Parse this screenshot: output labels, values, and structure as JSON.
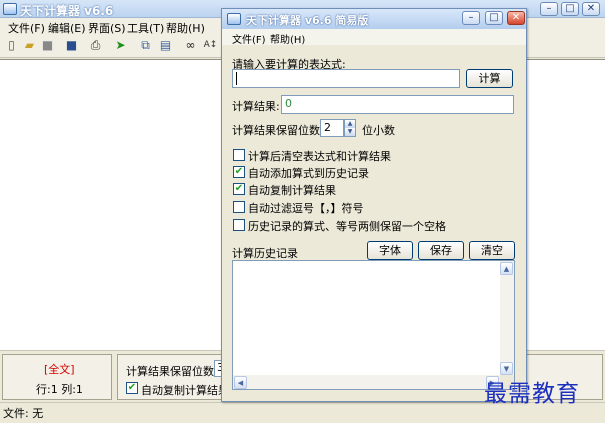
{
  "main_window": {
    "title": "天下计算器 v6.6",
    "menu": [
      "文件(F)",
      "编辑(E)",
      "界面(S)",
      "工具(T)",
      "帮助(H)"
    ],
    "status_all": "[全文]",
    "row_col": "行:1  列:1",
    "precision_label": "计算结果保留位数:",
    "precision_value": "3",
    "auto_copy_label": "自动复制计算结果",
    "status_file": "文件: 无"
  },
  "dialog": {
    "title": "天下计算器 v6.6 简易版",
    "menu": [
      "文件(F)",
      "帮助(H)"
    ],
    "expression_label": "请输入要计算的表达式:",
    "expression_value": "",
    "calculate_button": "计算",
    "result_label": "计算结果:",
    "result_value": "0",
    "precision_label": "计算结果保留位数:",
    "precision_value": "2",
    "precision_suffix": "位小数",
    "options": [
      {
        "label": "计算后清空表达式和计算结果",
        "checked": false
      },
      {
        "label": "自动添加算式到历史记录",
        "checked": true
      },
      {
        "label": "自动复制计算结果",
        "checked": true
      },
      {
        "label": "自动过滤逗号【，】符号",
        "checked": false
      },
      {
        "label": "历史记录的算式、等号两侧保留一个空格",
        "checked": false
      }
    ],
    "history_label": "计算历史记录",
    "font_button": "字体",
    "save_button": "保存",
    "clear_button": "清空"
  },
  "watermark": "最需教育",
  "colors": {
    "result_text": "#2f8b3a",
    "status_all": "#d40000",
    "watermark": "#1d2fc0"
  }
}
